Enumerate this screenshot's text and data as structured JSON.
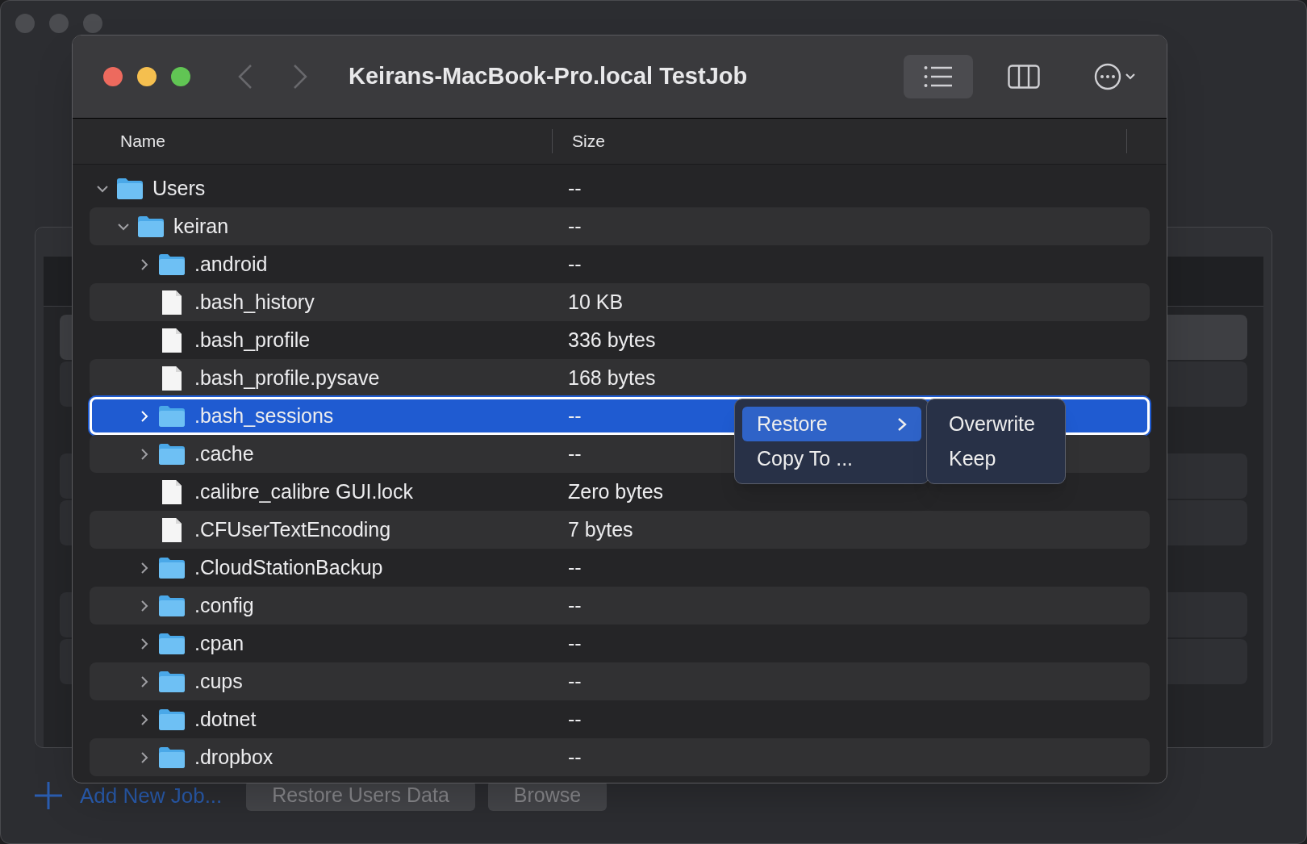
{
  "window": {
    "title": "Keirans-MacBook-Pro.local TestJob"
  },
  "toolbar": {
    "views": [
      {
        "kind": "list",
        "selected": true
      },
      {
        "kind": "columns",
        "selected": false
      }
    ],
    "nav": [
      {
        "kind": "back",
        "disabled": true
      },
      {
        "kind": "forward",
        "disabled": true
      }
    ]
  },
  "table": {
    "columns": [
      "Name",
      "Size"
    ],
    "rows": [
      {
        "name": "Users",
        "size": "--",
        "kind": "folder",
        "expanded": true,
        "selected": false,
        "children": [
          {
            "name": "keiran",
            "size": "--",
            "kind": "folder",
            "expanded": true,
            "selected": false,
            "children": [
              {
                "name": ".android",
                "size": "--",
                "kind": "folder",
                "expanded": false,
                "selected": false
              },
              {
                "name": ".bash_history",
                "size": "10 KB",
                "kind": "file",
                "selected": false
              },
              {
                "name": ".bash_profile",
                "size": "336 bytes",
                "kind": "file",
                "selected": false
              },
              {
                "name": ".bash_profile.pysave",
                "size": "168 bytes",
                "kind": "file",
                "selected": false
              },
              {
                "name": ".bash_sessions",
                "size": "--",
                "kind": "folder",
                "expanded": false,
                "selected": true
              },
              {
                "name": ".cache",
                "size": "--",
                "kind": "folder",
                "expanded": false,
                "selected": false
              },
              {
                "name": ".calibre_calibre GUI.lock",
                "size": "Zero bytes",
                "kind": "file",
                "selected": false
              },
              {
                "name": ".CFUserTextEncoding",
                "size": "7 bytes",
                "kind": "file",
                "selected": false
              },
              {
                "name": ".CloudStationBackup",
                "size": "--",
                "kind": "folder",
                "expanded": false,
                "selected": false
              },
              {
                "name": ".config",
                "size": "--",
                "kind": "folder",
                "expanded": false,
                "selected": false
              },
              {
                "name": ".cpan",
                "size": "--",
                "kind": "folder",
                "expanded": false,
                "selected": false
              },
              {
                "name": ".cups",
                "size": "--",
                "kind": "folder",
                "expanded": false,
                "selected": false
              },
              {
                "name": ".dotnet",
                "size": "--",
                "kind": "folder",
                "expanded": false,
                "selected": false
              },
              {
                "name": ".dropbox",
                "size": "--",
                "kind": "folder",
                "expanded": false,
                "selected": false
              }
            ]
          }
        ]
      }
    ]
  },
  "context_menu": {
    "items": [
      {
        "label": "Restore",
        "selected": true,
        "submenu": true
      },
      {
        "label": "Copy To ...",
        "selected": false,
        "submenu": false
      }
    ],
    "submenu": {
      "items": [
        {
          "label": "Overwrite"
        },
        {
          "label": "Keep"
        }
      ]
    }
  },
  "bottom_bar": {
    "add_link": "Add New Job...",
    "buttons": [
      {
        "label": "Restore Users Data",
        "disabled": true
      },
      {
        "label": "Browse",
        "disabled": true
      }
    ]
  }
}
